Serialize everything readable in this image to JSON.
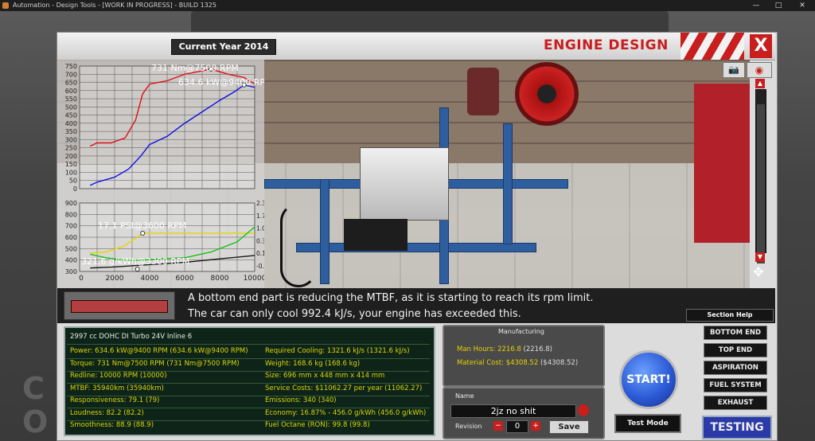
{
  "window": {
    "title": "Automation - Design Tools - [WORK IN PROGRESS] - BUILD 1325",
    "minimize": "—",
    "maximize": "□",
    "close": "✕"
  },
  "header": {
    "year_label": "Current Year 2014",
    "title": "ENGINE DESIGN",
    "close": "X"
  },
  "icons": {
    "camera": "camera-icon",
    "eye": "eye-icon",
    "nav": "nav-arrows-icon"
  },
  "chart_data": [
    {
      "type": "line",
      "title": "",
      "yticks": [
        0,
        50,
        100,
        150,
        200,
        250,
        300,
        350,
        400,
        450,
        500,
        550,
        600,
        650,
        700,
        750
      ],
      "annotations": [
        "731 Nm@7500 RPM",
        "634.6 kW@9400 RPM"
      ],
      "series": [
        {
          "name": "torque",
          "color": "#e01010",
          "x": [
            600,
            1000,
            1800,
            2600,
            3200,
            3600,
            4000,
            5000,
            6000,
            7500,
            8500,
            9400,
            10000
          ],
          "y": [
            260,
            280,
            280,
            310,
            420,
            580,
            640,
            660,
            700,
            731,
            700,
            680,
            640
          ]
        },
        {
          "name": "power",
          "color": "#1010e0",
          "x": [
            600,
            1000,
            2000,
            2800,
            3500,
            4000,
            5000,
            6000,
            7000,
            8000,
            8800,
            9400,
            10000
          ],
          "y": [
            20,
            40,
            70,
            120,
            200,
            270,
            320,
            400,
            470,
            540,
            590,
            634.6,
            620
          ]
        }
      ],
      "xlim": [
        0,
        10000
      ],
      "ylim": [
        0,
        750
      ]
    },
    {
      "type": "line",
      "title": "",
      "xticks": [
        2000,
        4000,
        6000,
        8000,
        10000
      ],
      "xlim": [
        0,
        10000
      ],
      "yticks_left": [
        300,
        400,
        500,
        600,
        700,
        800,
        900
      ],
      "ylim_left": [
        300,
        900
      ],
      "yticks_right_labels": [
        "-0.3",
        "0.1",
        "0.3",
        "1.0",
        "1.7",
        "2.3"
      ],
      "annotations": [
        "17.1 PSI@3600 RPM",
        "321.6 g/kWh@3300 RPM"
      ],
      "series": [
        {
          "name": "boost",
          "color": "#e8d400",
          "x": [
            600,
            1500,
            2500,
            3300,
            3600,
            5000,
            7000,
            9000,
            10000
          ],
          "y": [
            460,
            470,
            520,
            600,
            635,
            635,
            635,
            635,
            635
          ]
        },
        {
          "name": "efficiency",
          "color": "#12c012",
          "x": [
            600,
            1500,
            2500,
            3300,
            4500,
            6000,
            7500,
            9000,
            10000
          ],
          "y": [
            450,
            420,
            400,
            395,
            410,
            420,
            470,
            560,
            690
          ]
        },
        {
          "name": "cooling",
          "color": "#1a1a1a",
          "x": [
            600,
            2000,
            4000,
            6000,
            8000,
            10000
          ],
          "y": [
            330,
            340,
            360,
            380,
            410,
            440
          ]
        }
      ]
    }
  ],
  "messages": {
    "line1": "A bottom end part is reducing the MTBF, as it is starting to reach its rpm limit.",
    "line2": "The car can only cool 992.4 kJ/s, your engine has exceeded this."
  },
  "section_help": "Section Help",
  "stats": {
    "header": "2997 cc DOHC DI Turbo 24V Inline 6",
    "left": [
      "Power: 634.6 kW@9400 RPM (634.6 kW@9400 RPM)",
      "Torque: 731 Nm@7500 RPM (731 Nm@7500 RPM)",
      "Redline: 10000 RPM (10000)",
      "MTBF: 35940km (35940km)",
      "Responsiveness: 79.1 (79)",
      "Loudness: 82.2 (82.2)",
      "Smoothness: 88.9 (88.9)"
    ],
    "right": [
      "Required Cooling: 1321.6 kJ/s (1321.6 kJ/s)",
      "Weight: 168.6 kg (168.6 kg)",
      "Size: 696 mm x 448 mm x 414 mm",
      "Service Costs: $11062.27 per year (11062.27)",
      "Emissions: 340 (340)",
      "Economy: 16.87% - 456.0 g/kWh (456.0 g/kWh)",
      "Fuel Octane (RON): 99.8 (99.8)"
    ]
  },
  "manufacturing": {
    "title": "Manufacturing",
    "man_hours_label": "Man Hours: 2216.8",
    "man_hours_paren": "(2216.8)",
    "material_label": "Material Cost: $4308.52",
    "material_paren": "($4308.52)"
  },
  "name_panel": {
    "label": "Name",
    "value": "2jz no shit",
    "revision_label": "Revision",
    "revision_value": "0",
    "save": "Save",
    "minus": "−",
    "plus": "+"
  },
  "controls": {
    "start": "START!",
    "test_mode": "Test Mode",
    "sections": [
      "BOTTOM END",
      "TOP END",
      "ASPIRATION",
      "FUEL SYSTEM",
      "EXHAUST"
    ],
    "testing": "TESTING"
  }
}
